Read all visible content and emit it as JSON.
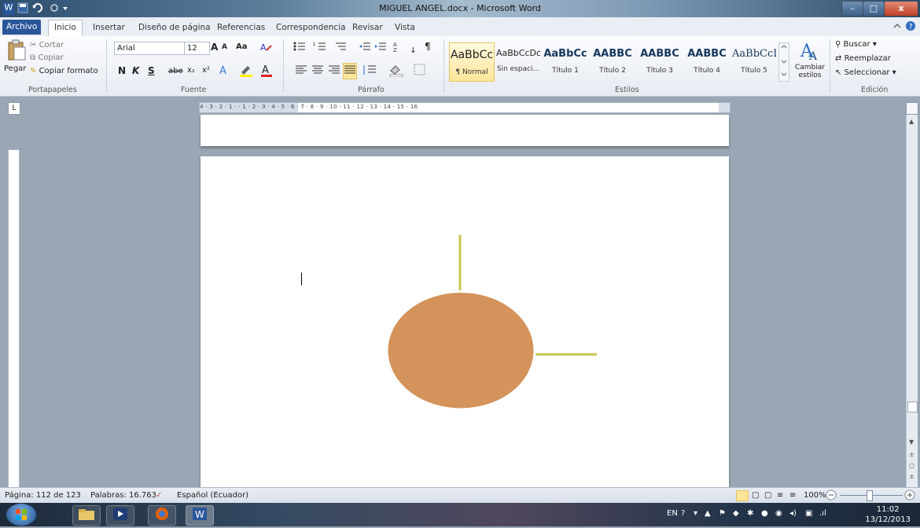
{
  "window": {
    "title": "MIGUEL ANGEL.docx - Microsoft Word",
    "app_icon": "W",
    "qa_save_icon": "save-icon",
    "qa_undo_icon": "undo-icon",
    "qa_redo_icon": "redo-icon",
    "min": "–",
    "max": "□",
    "close": "x"
  },
  "tabs": [
    "Archivo",
    "Inicio",
    "Insertar",
    "Diseño de página",
    "Referencias",
    "Correspondencia",
    "Revisar",
    "Vista"
  ],
  "clipboard": {
    "paste": "Pegar",
    "cut": "Cortar",
    "copy": "Copiar",
    "format_painter": "Copiar formato",
    "group_label": "Portapapeles"
  },
  "font": {
    "name": "Arial",
    "size": "12",
    "bold": "N",
    "italic": "K",
    "underline": "S",
    "strike": "abe",
    "sub": "x₂",
    "sup": "x²",
    "grow": "A",
    "shrink": "A",
    "case": "Aa",
    "group_label": "Fuente"
  },
  "paragraph": {
    "sort": "↓",
    "pilcrow": "¶",
    "group_label": "Párrafo"
  },
  "styles": {
    "items": [
      {
        "sample": "AaBbCc",
        "name": "¶ Normal"
      },
      {
        "sample": "AaBbCcDc",
        "name": "Sin espaci..."
      },
      {
        "sample": "AaBbCc",
        "name": "Título 1"
      },
      {
        "sample": "AABBC",
        "name": "Título 2"
      },
      {
        "sample": "AABBC",
        "name": "Título 3"
      },
      {
        "sample": "AABBC",
        "name": "Título 4"
      },
      {
        "sample": "AaBbCcI",
        "name": "Título 5"
      }
    ],
    "change_styles": "Cambiar estilos",
    "group_label": "Estilos"
  },
  "editing": {
    "find": "Buscar",
    "replace": "Reemplazar",
    "select": "Seleccionar",
    "group_label": "Edición"
  },
  "ruler": {
    "marks": "4 · 3 · 2 · 1 · · 1 · 2 · 3 · 4 · 5 · 6 · 7 · 8 · 9 · 10 · 11 · 12 · 13 · 14 · 15 · 16"
  },
  "shape": {
    "fill": "#d4935a",
    "line_color": "#c8c44c"
  },
  "status": {
    "page": "Página: 112 de 123",
    "words": "Palabras: 16.763",
    "language": "Español (Ecuador)",
    "zoom": "100%"
  },
  "taskbar": {
    "lang": "EN",
    "time": "11:02",
    "date": "13/12/2013"
  }
}
